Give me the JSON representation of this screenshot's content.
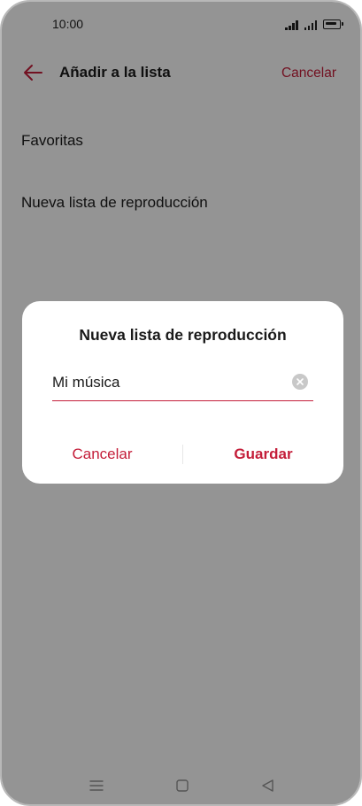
{
  "status_bar": {
    "time": "10:00"
  },
  "header": {
    "back_icon": "arrow-left-icon",
    "title": "Añadir a la lista",
    "cancel_label": "Cancelar"
  },
  "list": {
    "items": [
      {
        "label": "Favoritas"
      },
      {
        "label": "Nueva lista de reproducción"
      }
    ]
  },
  "dialog": {
    "title": "Nueva lista de reproducción",
    "input_value": "Mi música",
    "clear_icon": "clear-circle-icon",
    "cancel_label": "Cancelar",
    "save_label": "Guardar"
  },
  "nav_bar": {
    "icons": [
      "menu-icon",
      "home-square-icon",
      "back-triangle-icon"
    ]
  },
  "colors": {
    "accent": "#c41e3a",
    "overlay": "rgba(0,0,0,0.42)",
    "dialog_bg": "#ffffff"
  }
}
